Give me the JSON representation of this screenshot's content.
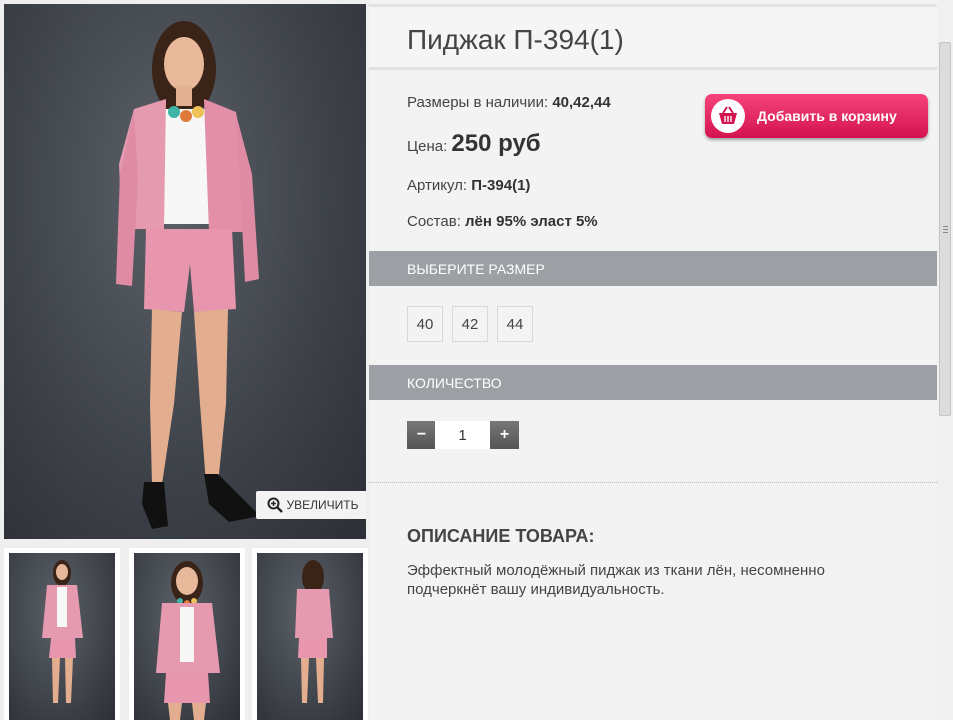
{
  "product": {
    "title": "Пиджак П-394(1)",
    "sizes_label": "Размеры в наличии:",
    "sizes_value": "40,42,44",
    "price_label": "Цена:",
    "price_value": "250 руб",
    "article_label": "Артикул:",
    "article_value": "П-394(1)",
    "composition_label": "Состав:",
    "composition_value": "лён 95% эласт 5%",
    "add_to_cart": "Добавить в корзину"
  },
  "gallery": {
    "zoom_label": "УВЕЛИЧИТЬ",
    "thumbnails": [
      "front",
      "close-up",
      "back"
    ]
  },
  "size_section": {
    "header": "ВЫБЕРИТЕ РАЗМЕР",
    "options": [
      "40",
      "42",
      "44"
    ]
  },
  "quantity_section": {
    "header": "КОЛИЧЕСТВО",
    "minus": "−",
    "plus": "+",
    "value": "1"
  },
  "description": {
    "title": "ОПИСАНИЕ ТОВАРА:",
    "text": "Эффектный молодёжный пиджак из ткани лён, несомненно подчеркнёт вашу индивидуальность."
  },
  "colors": {
    "accent": "#e0205c",
    "section_header": "#9c9fa3",
    "jacket": "#e69ab0"
  }
}
